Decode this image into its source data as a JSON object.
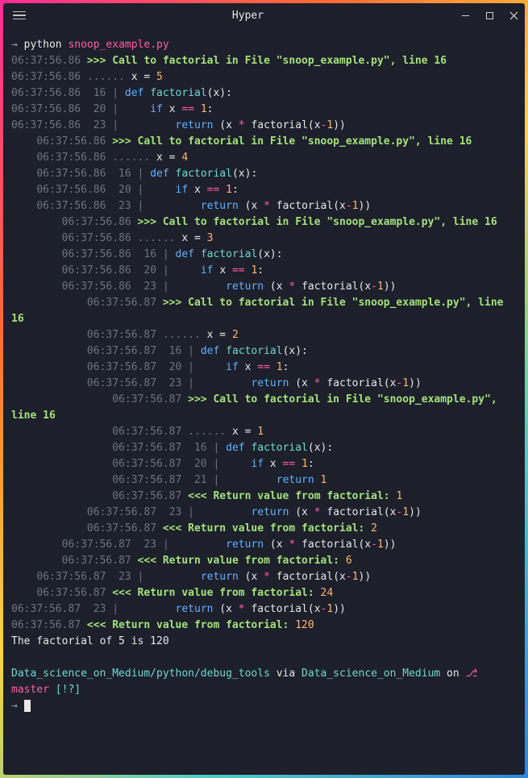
{
  "window": {
    "title": "Hyper"
  },
  "cmd": {
    "arrow": "→",
    "bin": "python",
    "script": "snoop_example.py"
  },
  "lines": [
    {
      "i": 0,
      "ts": "06:37:56.86",
      "type": "call",
      "msg": ">>> Call to factorial in File \"snoop_example.py\", line 16"
    },
    {
      "i": 0,
      "ts": "06:37:56.86",
      "type": "var",
      "dots": "......",
      "var": "x",
      "eq": "=",
      "val": "5"
    },
    {
      "i": 0,
      "ts": "06:37:56.86",
      "type": "code",
      "ln": "16",
      "kw": "def",
      "fn": "factorial",
      "args": "(x):"
    },
    {
      "i": 0,
      "ts": "06:37:56.86",
      "type": "code",
      "ln": "20",
      "pre": "    ",
      "kw": "if",
      "var": "x",
      "op": "==",
      "val": "1",
      "tail": ":"
    },
    {
      "i": 0,
      "ts": "06:37:56.86",
      "type": "code",
      "ln": "23",
      "pre": "        ",
      "kw": "return",
      "tail": " (x ",
      "op": "*",
      "rest": " factorial(x",
      "minus": "-",
      "one": "1",
      "end": "))"
    },
    {
      "i": 1,
      "ts": "06:37:56.86",
      "type": "call",
      "msg": ">>> Call to factorial in File \"snoop_example.py\", line 16"
    },
    {
      "i": 1,
      "ts": "06:37:56.86",
      "type": "var",
      "dots": "......",
      "var": "x",
      "eq": "=",
      "val": "4"
    },
    {
      "i": 1,
      "ts": "06:37:56.86",
      "type": "code",
      "ln": "16",
      "kw": "def",
      "fn": "factorial",
      "args": "(x):"
    },
    {
      "i": 1,
      "ts": "06:37:56.86",
      "type": "code",
      "ln": "20",
      "pre": "    ",
      "kw": "if",
      "var": "x",
      "op": "==",
      "val": "1",
      "tail": ":"
    },
    {
      "i": 1,
      "ts": "06:37:56.86",
      "type": "code",
      "ln": "23",
      "pre": "        ",
      "kw": "return",
      "tail": " (x ",
      "op": "*",
      "rest": " factorial(x",
      "minus": "-",
      "one": "1",
      "end": "))"
    },
    {
      "i": 2,
      "ts": "06:37:56.86",
      "type": "call",
      "msg": ">>> Call to factorial in File \"snoop_example.py\", line 16"
    },
    {
      "i": 2,
      "ts": "06:37:56.86",
      "type": "var",
      "dots": "......",
      "var": "x",
      "eq": "=",
      "val": "3"
    },
    {
      "i": 2,
      "ts": "06:37:56.86",
      "type": "code",
      "ln": "16",
      "kw": "def",
      "fn": "factorial",
      "args": "(x):"
    },
    {
      "i": 2,
      "ts": "06:37:56.86",
      "type": "code",
      "ln": "20",
      "pre": "    ",
      "kw": "if",
      "var": "x",
      "op": "==",
      "val": "1",
      "tail": ":"
    },
    {
      "i": 2,
      "ts": "06:37:56.86",
      "type": "code",
      "ln": "23",
      "pre": "        ",
      "kw": "return",
      "tail": " (x ",
      "op": "*",
      "rest": " factorial(x",
      "minus": "-",
      "one": "1",
      "end": "))"
    },
    {
      "i": 3,
      "ts": "06:37:56.87",
      "type": "call",
      "msg": ">>> Call to factorial in File \"snoop_example.py\", line 16"
    },
    {
      "i": 3,
      "ts": "06:37:56.87",
      "type": "var",
      "dots": "......",
      "var": "x",
      "eq": "=",
      "val": "2"
    },
    {
      "i": 3,
      "ts": "06:37:56.87",
      "type": "code",
      "ln": "16",
      "kw": "def",
      "fn": "factorial",
      "args": "(x):"
    },
    {
      "i": 3,
      "ts": "06:37:56.87",
      "type": "code",
      "ln": "20",
      "pre": "    ",
      "kw": "if",
      "var": "x",
      "op": "==",
      "val": "1",
      "tail": ":"
    },
    {
      "i": 3,
      "ts": "06:37:56.87",
      "type": "code",
      "ln": "23",
      "pre": "        ",
      "kw": "return",
      "tail": " (x ",
      "op": "*",
      "rest": " factorial(x",
      "minus": "-",
      "one": "1",
      "end": "))"
    },
    {
      "i": 4,
      "ts": "06:37:56.87",
      "type": "call",
      "msg": ">>> Call to factorial in File \"snoop_example.py\", line 16"
    },
    {
      "i": 4,
      "ts": "06:37:56.87",
      "type": "var",
      "dots": "......",
      "var": "x",
      "eq": "=",
      "val": "1"
    },
    {
      "i": 4,
      "ts": "06:37:56.87",
      "type": "code",
      "ln": "16",
      "kw": "def",
      "fn": "factorial",
      "args": "(x):"
    },
    {
      "i": 4,
      "ts": "06:37:56.87",
      "type": "code",
      "ln": "20",
      "pre": "    ",
      "kw": "if",
      "var": "x",
      "op": "==",
      "val": "1",
      "tail": ":"
    },
    {
      "i": 4,
      "ts": "06:37:56.87",
      "type": "code",
      "ln": "21",
      "pre": "        ",
      "kw": "return",
      "tail": " ",
      "val": "1"
    },
    {
      "i": 4,
      "ts": "06:37:56.87",
      "type": "ret",
      "msg": "<<< Return value from factorial:",
      "val": "1"
    },
    {
      "i": 3,
      "ts": "06:37:56.87",
      "type": "code",
      "ln": "23",
      "pre": "        ",
      "kw": "return",
      "tail": " (x ",
      "op": "*",
      "rest": " factorial(x",
      "minus": "-",
      "one": "1",
      "end": "))"
    },
    {
      "i": 3,
      "ts": "06:37:56.87",
      "type": "ret",
      "msg": "<<< Return value from factorial:",
      "val": "2"
    },
    {
      "i": 2,
      "ts": "06:37:56.87",
      "type": "code",
      "ln": "23",
      "pre": "        ",
      "kw": "return",
      "tail": " (x ",
      "op": "*",
      "rest": " factorial(x",
      "minus": "-",
      "one": "1",
      "end": "))"
    },
    {
      "i": 2,
      "ts": "06:37:56.87",
      "type": "ret",
      "msg": "<<< Return value from factorial:",
      "val": "6"
    },
    {
      "i": 1,
      "ts": "06:37:56.87",
      "type": "code",
      "ln": "23",
      "pre": "        ",
      "kw": "return",
      "tail": " (x ",
      "op": "*",
      "rest": " factorial(x",
      "minus": "-",
      "one": "1",
      "end": "))"
    },
    {
      "i": 1,
      "ts": "06:37:56.87",
      "type": "ret",
      "msg": "<<< Return value from factorial:",
      "val": "24"
    },
    {
      "i": 0,
      "ts": "06:37:56.87",
      "type": "code",
      "ln": "23",
      "pre": "        ",
      "kw": "return",
      "tail": " (x ",
      "op": "*",
      "rest": " factorial(x",
      "minus": "-",
      "one": "1",
      "end": "))"
    },
    {
      "i": 0,
      "ts": "06:37:56.87",
      "type": "ret",
      "msg": "<<< Return value from factorial:",
      "val": "120"
    }
  ],
  "result_text": "The factorial of 5 is 120",
  "prompt2": {
    "path": "Data_science_on_Medium/python/debug_tools",
    "via": " via ",
    "env": "Data_science_on_Medium",
    "on": " on ",
    "branch": "master",
    "status": "[!?]",
    "arrow": "→"
  }
}
